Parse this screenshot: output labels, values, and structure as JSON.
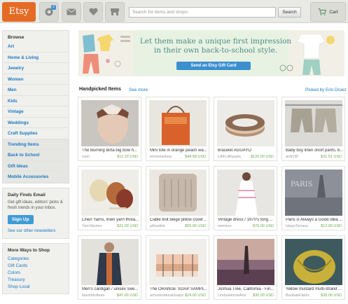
{
  "header": {
    "logo": "Etsy",
    "badge_count": "2",
    "search": {
      "placeholder": "Search for items and shops",
      "button_label": "Search"
    },
    "cart_label": "Cart"
  },
  "sidebar": {
    "browse_title": "Browse",
    "categories": [
      "Art",
      "Home & Living",
      "Jewelry",
      "Women",
      "Men",
      "Kids",
      "Vintage",
      "Weddings",
      "Craft Supplies",
      "Trending Items",
      "Back to School",
      "Gift Ideas",
      "Mobile Accessories"
    ],
    "daily": {
      "title": "Daily Finds Email",
      "text": "Get gift ideas, editors' picks & fresh trends in your inbox.",
      "button_label": "Sign Up",
      "link": "See our other newsletters"
    },
    "ways": {
      "title": "More Ways to Shop",
      "items": [
        "Categories",
        "Gift Cards",
        "Colors",
        "Treasury",
        "Shop Local"
      ]
    }
  },
  "banner": {
    "line1": "Let them make a unique first impression",
    "line2": "in their own back-to-school style.",
    "button_label": "Send an Etsy Gift Card"
  },
  "handpicked": {
    "title": "Handpicked Items",
    "see_more": "See more",
    "picked_by": "Picked by Erin Druez",
    "items": [
      {
        "title": "The Burning Birta big bow h...",
        "shop": "raori",
        "price": "$12.33 USD"
      },
      {
        "title": "Mini tote in orange peach wa...",
        "shop": "emmiesshop",
        "price": "$44.58 USD"
      },
      {
        "title": "bracelet AGUAYO",
        "shop": "LAKLAKparts",
        "price": "$120.00 USD"
      },
      {
        "title": "Baby boy linen shorf pants, b...",
        "shop": "ardi190",
        "price": "$31.51 USD"
      },
      {
        "title": "Linen Yarns, linen yarn threa...",
        "shop": "YarnStories",
        "price": "$21.00 USD"
      },
      {
        "title": "Cable knit beige pillow cover...",
        "shop": "pillowlink",
        "price": "$55.00 USD"
      },
      {
        "title": "Vintage dress / 1970's long ...",
        "shop": "nemires",
        "price": "$79.00 USD"
      },
      {
        "title": "Paris is Always a Good Idea ...",
        "shop": "IslaysTerrace",
        "price": "$12.00 USD"
      },
      {
        "title": "Men's cardigan / unisex swe...",
        "shop": "blackbirdtees",
        "price": "$47.00 USD"
      },
      {
        "title": "The ORANGE SOAP SAMPL...",
        "shop": "amuminaturalsoaps",
        "price": "$24.00 USD"
      },
      {
        "title": "Joshua Tree, California - Fin...",
        "shop": "LindsaHomeArts",
        "price": "$30.00 USD"
      },
      {
        "title": "Yellow mustard multi-strand ...",
        "shop": "BaobabFabric",
        "price": "$28.00 USD"
      }
    ]
  },
  "colors": {
    "logo": "#e56b25",
    "link": "#1a78c2",
    "button": "#3f9bd6",
    "price": "#6aa84f",
    "banner_bg": "#e8f2e2"
  }
}
